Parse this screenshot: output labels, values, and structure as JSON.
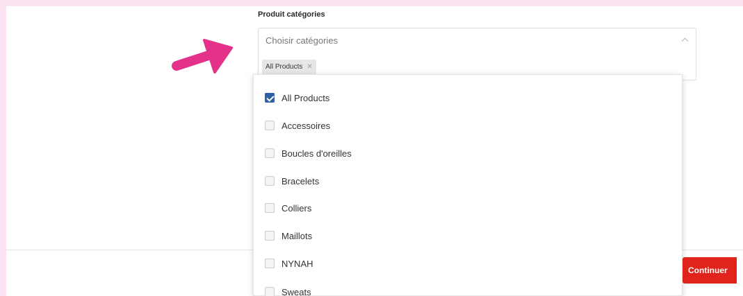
{
  "section": {
    "label": "Produit catégories"
  },
  "select": {
    "placeholder": "Choisir catégories",
    "chevron_icon": "chevron-up-icon"
  },
  "selected_tags": [
    {
      "label": "All Products",
      "remove_icon": "close-icon"
    }
  ],
  "options": [
    {
      "label": "All Products",
      "checked": true
    },
    {
      "label": "Accessoires",
      "checked": false
    },
    {
      "label": "Boucles d'oreilles",
      "checked": false
    },
    {
      "label": "Bracelets",
      "checked": false
    },
    {
      "label": "Colliers",
      "checked": false
    },
    {
      "label": "Maillots",
      "checked": false
    },
    {
      "label": "NYNAH",
      "checked": false
    },
    {
      "label": "Sweats",
      "checked": false
    }
  ],
  "footer": {
    "continue_label": "Continuer"
  },
  "annotation": {
    "arrow_icon": "pointer-arrow-icon",
    "arrow_color": "#e4318a"
  },
  "colors": {
    "page_background": "#fbe3f2",
    "checkbox_checked": "#2f5fa7",
    "primary_button": "#e0241b"
  }
}
